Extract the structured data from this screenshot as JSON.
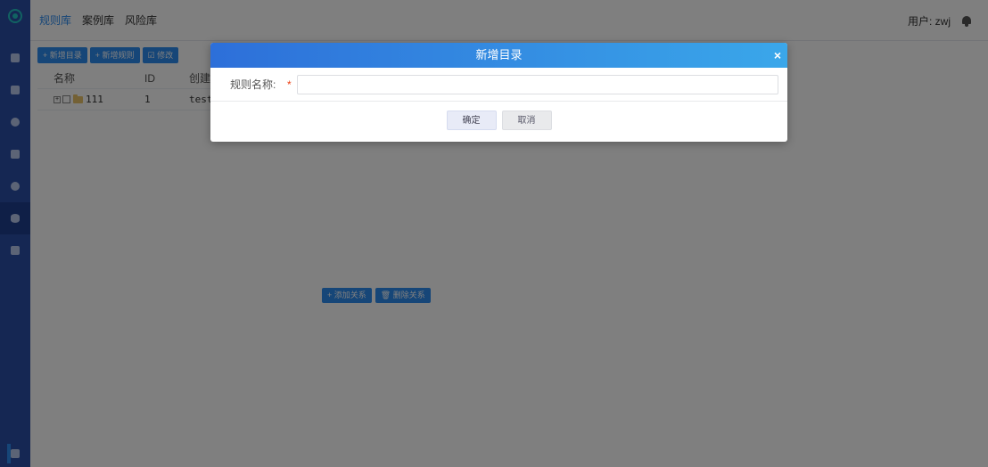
{
  "topbar": {
    "tabs": [
      {
        "label": "规则库",
        "active": true
      },
      {
        "label": "案例库",
        "active": false
      },
      {
        "label": "风险库",
        "active": false
      }
    ],
    "user_label": "用户: zwj",
    "bell_icon": "bell-icon"
  },
  "sidebar": {
    "items": [
      {
        "icon": "monitor-icon"
      },
      {
        "icon": "document-icon"
      },
      {
        "icon": "layers-icon"
      },
      {
        "icon": "server-icon"
      },
      {
        "icon": "clock-icon"
      },
      {
        "icon": "database-icon",
        "active": true
      },
      {
        "icon": "file-icon"
      }
    ],
    "bottom_icon": "menu-icon"
  },
  "toolbar": {
    "add_dir": "+ 新增目录",
    "add_rule": "+ 新增规则",
    "edit": "☑ 修改"
  },
  "table": {
    "headers": [
      "名称",
      "ID",
      "创建"
    ],
    "rows": [
      {
        "name": "111",
        "id": "1",
        "creator": "test"
      }
    ]
  },
  "relations": {
    "add": "+ 添加关系",
    "delete": "🗑 删除关系"
  },
  "modal": {
    "title": "新增目录",
    "close": "×",
    "field_label": "规则名称:",
    "required_mark": "*",
    "field_value": "",
    "ok_label": "确定",
    "cancel_label": "取消"
  },
  "colors": {
    "sidebar": "#2b4fa6",
    "primary": "#2d8cf0",
    "modal_header_start": "#2d6fd9",
    "modal_header_end": "#3aa7ea"
  }
}
